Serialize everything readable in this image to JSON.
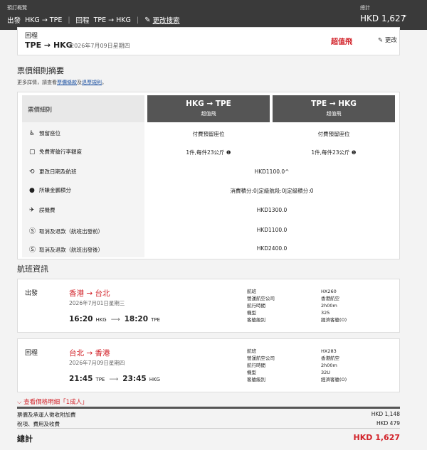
{
  "topbar": {
    "label": "預訂概覽",
    "outbound_label": "出發",
    "outbound_route": "HKG → TPE",
    "return_label": "回程",
    "return_route": "TPE → HKG",
    "edit_search": "更改搜索",
    "total_label": "總計",
    "total_value": "HKD 1,627"
  },
  "return_card": {
    "label": "回程",
    "route": "TPE → HKG",
    "date": "2026年7月09日星期四",
    "fare_tag": "超值飛",
    "edit": "更改"
  },
  "fare_summary": {
    "title": "票價細則摘要",
    "note_prefix": "更多詳情，請查看",
    "note_link1": "票價條款",
    "note_and": "及",
    "note_link2": "退票規則",
    "note_suffix": "。",
    "header_label": "票價細則",
    "columns": [
      {
        "route": "HKG  →  TPE",
        "fare": "超值飛"
      },
      {
        "route": "TPE  →  HKG",
        "fare": "超值飛"
      }
    ],
    "rows": [
      {
        "label": "預留座位",
        "icon": "seat-icon",
        "v1": "付費預留座位",
        "v2": "付費預留座位"
      },
      {
        "label": "免費寄艙行李額度",
        "icon": "baggage-icon",
        "v1": "1件,每件23公斤 ❶",
        "v2": "1件,每件23公斤 ❶"
      },
      {
        "label": "更改日期及航班",
        "icon": "change-icon",
        "merged": "HKD1100.0^"
      },
      {
        "label": "所賺金鵬積分",
        "icon": "miles-icon",
        "merged": "消費積分:0|定級航段:0|定級積分:0"
      },
      {
        "label": "誤機費",
        "icon": "plane-icon",
        "merged": "HKD1300.0"
      },
      {
        "label": "取消及退款（航班出發前）",
        "icon": "refund-icon",
        "merged": "HKD1100.0"
      },
      {
        "label": "取消及退款（航班出發後）",
        "icon": "refund-icon",
        "merged": "HKD2400.0"
      }
    ]
  },
  "flight_info": {
    "title": "航班資訊",
    "flights": [
      {
        "direction": "出發",
        "cities": "香港 → 台北",
        "date": "2026年7月01日星期三",
        "dep_time": "16:20",
        "dep_code": "HKG",
        "arr_time": "18:20",
        "arr_code": "TPE",
        "info": [
          [
            "航班",
            "HX260"
          ],
          [
            "營運航空公司",
            "香港航空"
          ],
          [
            "航行時間",
            "2h00m"
          ],
          [
            "機型",
            "325"
          ],
          [
            "客艙級別",
            "經濟客艙(O)"
          ]
        ]
      },
      {
        "direction": "回程",
        "cities": "台北 → 香港",
        "date": "2026年7月09日星期四",
        "dep_time": "21:45",
        "dep_code": "TPE",
        "arr_time": "23:45",
        "arr_code": "HKG",
        "info": [
          [
            "航班",
            "HX283"
          ],
          [
            "營運航空公司",
            "香港航空"
          ],
          [
            "航行時間",
            "2h00m"
          ],
          [
            "機型",
            "32U"
          ],
          [
            "客艙級別",
            "經濟客艙(O)"
          ]
        ]
      }
    ]
  },
  "price": {
    "view_detail": "查看價格明細「1成人」",
    "fare_surcharge_label": "票價及承運人徵收附加費",
    "fare_surcharge_value": "HKD 1,148",
    "tax_label": "稅項、費用及收費",
    "tax_value": "HKD 479",
    "total_label": "總計",
    "total_value": "HKD 1,627"
  },
  "colors": {
    "accent": "#d2232a",
    "topbar": "#3a3a3a",
    "header_dark": "#555555"
  }
}
